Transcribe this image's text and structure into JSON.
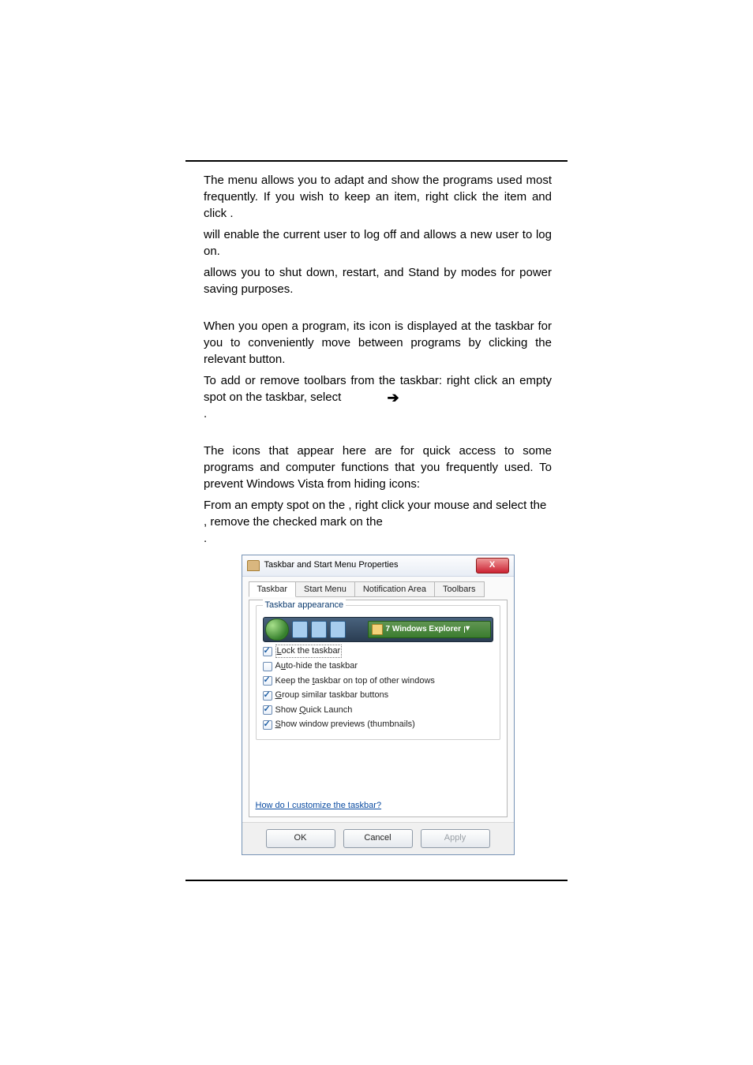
{
  "paragraphs": {
    "p1_a": "The ",
    "p1_b": " menu allows you to adapt and show the programs used most frequently. If you wish to keep an item, right click the item and click ",
    "p1_c": ".",
    "p2_b": " will enable the current user to log off and allows a new user to log on.",
    "p3_b": " allows you to shut down, restart, and Stand by modes for power saving purposes.",
    "p4": "When you open a program, its icon is displayed at the taskbar for you to conveniently move between programs by clicking the relevant button.",
    "p5_a": "To add or remove toolbars from the taskbar: right click an empty spot on the taskbar, select ",
    "p5_b": ".",
    "p6": "The icons that appear here are for quick access to some programs and computer functions that you frequently used. To prevent Windows Vista from hiding icons:",
    "p7_a": "From an empty spot on the ",
    "p7_b": ", right click your mouse and select the ",
    "p7_c": ", remove the checked mark on the ",
    "p7_d": "."
  },
  "dialog": {
    "title": "Taskbar and Start Menu Properties",
    "close": "X",
    "tabs": [
      "Taskbar",
      "Start Menu",
      "Notification Area",
      "Toolbars"
    ],
    "group_title": "Taskbar appearance",
    "dropdown": "7 Windows Explorer",
    "checks": [
      {
        "checked": true,
        "label_pre": "",
        "label_u": "L",
        "label_post": "ock the taskbar",
        "focused": true
      },
      {
        "checked": false,
        "label_pre": "A",
        "label_u": "u",
        "label_post": "to-hide the taskbar",
        "focused": false
      },
      {
        "checked": true,
        "label_pre": "Keep the ",
        "label_u": "t",
        "label_post": "askbar on top of other windows",
        "focused": false
      },
      {
        "checked": true,
        "label_pre": "",
        "label_u": "G",
        "label_post": "roup similar taskbar buttons",
        "focused": false
      },
      {
        "checked": true,
        "label_pre": "Show ",
        "label_u": "Q",
        "label_post": "uick Launch",
        "focused": false
      },
      {
        "checked": true,
        "label_pre": "",
        "label_u": "S",
        "label_post": "how window previews (thumbnails)",
        "focused": false
      }
    ],
    "link": "How do I customize the taskbar?",
    "buttons": {
      "ok": "OK",
      "cancel": "Cancel",
      "apply": "Apply"
    }
  }
}
